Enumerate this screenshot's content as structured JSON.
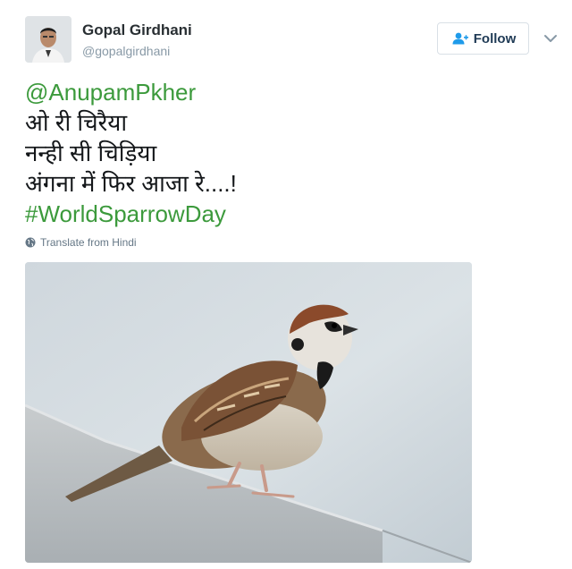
{
  "author": {
    "name": "Gopal Girdhani",
    "handle": "@gopalgirdhani"
  },
  "follow_button": {
    "label": "Follow",
    "icon": "follow-person-plus-icon"
  },
  "menu": {
    "icon": "chevron-down-icon"
  },
  "tweet": {
    "mention": "@AnupamPkher",
    "lines": [
      "ओ री चिरैया",
      "नन्ही सी चिड़िया",
      "अंगना में फिर आजा रे....!"
    ],
    "hashtag": "#WorldSparrowDay"
  },
  "translate": {
    "label": "Translate from Hindi",
    "icon": "globe-icon"
  },
  "media": {
    "icon": "sparrow-photo"
  },
  "colors": {
    "link": "#3c9a3c",
    "follow_text": "#1f3a55",
    "handle": "#8899a6"
  }
}
